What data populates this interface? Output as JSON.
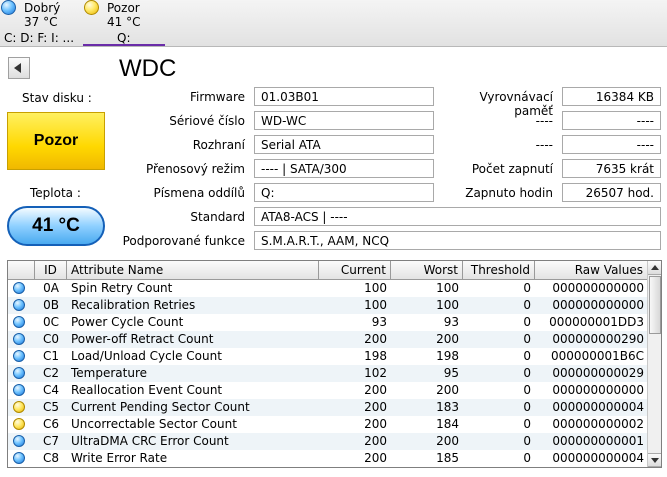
{
  "tabs": [
    {
      "status": "Dobrý",
      "temp": "37 °C",
      "letters": "C: D: F: I: ...",
      "color": "#3a9af0"
    },
    {
      "status": "Pozor",
      "temp": "41 °C",
      "letters": "Q:",
      "color": "#f5d000"
    }
  ],
  "model": "WDC",
  "left": {
    "status_label": "Stav disku :",
    "status_value": "Pozor",
    "temp_label": "Teplota :",
    "temp_value": "41 °C"
  },
  "fields": {
    "firmware_label": "Firmware",
    "firmware": "01.03B01",
    "serial_label": "Sériové číslo",
    "serial": "WD-WC",
    "interface_label": "Rozhraní",
    "interface": "Serial ATA",
    "transfer_label": "Přenosový režim",
    "transfer": "---- | SATA/300",
    "letters_label": "Písmena oddílů",
    "letters": "Q:",
    "standard_label": "Standard",
    "standard": "ATA8-ACS | ----",
    "features_label": "Podporované funkce",
    "features": "S.M.A.R.T., AAM, NCQ",
    "buffer_label": "Vyrovnávací paměť",
    "buffer": "16384 KB",
    "blank1_label": "----",
    "blank1": "----",
    "blank2_label": "----",
    "blank2": "----",
    "power_count_label": "Počet zapnutí",
    "power_count": "7635 krát",
    "power_hours_label": "Zapnuto hodin",
    "power_hours": "26507 hod."
  },
  "table": {
    "headers": [
      "ID",
      "Attribute Name",
      "Current",
      "Worst",
      "Threshold",
      "Raw Values"
    ],
    "rows": [
      {
        "status": "blue",
        "id": "0A",
        "name": "Spin Retry Count",
        "current": "100",
        "worst": "100",
        "threshold": "0",
        "raw": "000000000000"
      },
      {
        "status": "blue",
        "id": "0B",
        "name": "Recalibration Retries",
        "current": "100",
        "worst": "100",
        "threshold": "0",
        "raw": "000000000000"
      },
      {
        "status": "blue",
        "id": "0C",
        "name": "Power Cycle Count",
        "current": "93",
        "worst": "93",
        "threshold": "0",
        "raw": "000000001DD3"
      },
      {
        "status": "blue",
        "id": "C0",
        "name": "Power-off Retract Count",
        "current": "200",
        "worst": "200",
        "threshold": "0",
        "raw": "000000000290"
      },
      {
        "status": "blue",
        "id": "C1",
        "name": "Load/Unload Cycle Count",
        "current": "198",
        "worst": "198",
        "threshold": "0",
        "raw": "000000001B6C"
      },
      {
        "status": "blue",
        "id": "C2",
        "name": "Temperature",
        "current": "102",
        "worst": "95",
        "threshold": "0",
        "raw": "000000000029"
      },
      {
        "status": "blue",
        "id": "C4",
        "name": "Reallocation Event Count",
        "current": "200",
        "worst": "200",
        "threshold": "0",
        "raw": "000000000000"
      },
      {
        "status": "yellow",
        "id": "C5",
        "name": "Current Pending Sector Count",
        "current": "200",
        "worst": "183",
        "threshold": "0",
        "raw": "000000000004"
      },
      {
        "status": "yellow",
        "id": "C6",
        "name": "Uncorrectable Sector Count",
        "current": "200",
        "worst": "184",
        "threshold": "0",
        "raw": "000000000002"
      },
      {
        "status": "blue",
        "id": "C7",
        "name": "UltraDMA CRC Error Count",
        "current": "200",
        "worst": "200",
        "threshold": "0",
        "raw": "000000000001"
      },
      {
        "status": "blue",
        "id": "C8",
        "name": "Write Error Rate",
        "current": "200",
        "worst": "185",
        "threshold": "0",
        "raw": "000000000004"
      }
    ]
  }
}
